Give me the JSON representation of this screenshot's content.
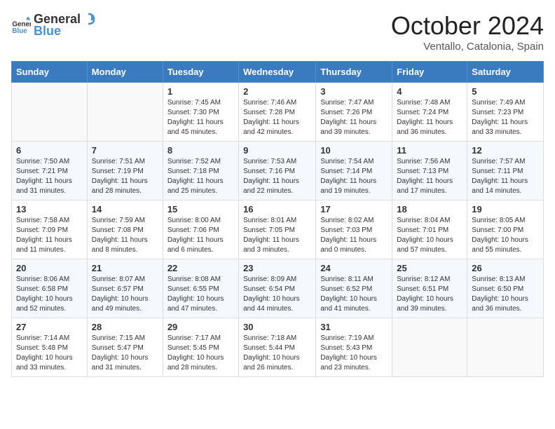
{
  "logo": {
    "general": "General",
    "blue": "Blue"
  },
  "header": {
    "month": "October 2024",
    "location": "Ventallo, Catalonia, Spain"
  },
  "weekdays": [
    "Sunday",
    "Monday",
    "Tuesday",
    "Wednesday",
    "Thursday",
    "Friday",
    "Saturday"
  ],
  "weeks": [
    [
      {
        "day": "",
        "sunrise": "",
        "sunset": "",
        "daylight": ""
      },
      {
        "day": "",
        "sunrise": "",
        "sunset": "",
        "daylight": ""
      },
      {
        "day": "1",
        "sunrise": "Sunrise: 7:45 AM",
        "sunset": "Sunset: 7:30 PM",
        "daylight": "Daylight: 11 hours and 45 minutes."
      },
      {
        "day": "2",
        "sunrise": "Sunrise: 7:46 AM",
        "sunset": "Sunset: 7:28 PM",
        "daylight": "Daylight: 11 hours and 42 minutes."
      },
      {
        "day": "3",
        "sunrise": "Sunrise: 7:47 AM",
        "sunset": "Sunset: 7:26 PM",
        "daylight": "Daylight: 11 hours and 39 minutes."
      },
      {
        "day": "4",
        "sunrise": "Sunrise: 7:48 AM",
        "sunset": "Sunset: 7:24 PM",
        "daylight": "Daylight: 11 hours and 36 minutes."
      },
      {
        "day": "5",
        "sunrise": "Sunrise: 7:49 AM",
        "sunset": "Sunset: 7:23 PM",
        "daylight": "Daylight: 11 hours and 33 minutes."
      }
    ],
    [
      {
        "day": "6",
        "sunrise": "Sunrise: 7:50 AM",
        "sunset": "Sunset: 7:21 PM",
        "daylight": "Daylight: 11 hours and 31 minutes."
      },
      {
        "day": "7",
        "sunrise": "Sunrise: 7:51 AM",
        "sunset": "Sunset: 7:19 PM",
        "daylight": "Daylight: 11 hours and 28 minutes."
      },
      {
        "day": "8",
        "sunrise": "Sunrise: 7:52 AM",
        "sunset": "Sunset: 7:18 PM",
        "daylight": "Daylight: 11 hours and 25 minutes."
      },
      {
        "day": "9",
        "sunrise": "Sunrise: 7:53 AM",
        "sunset": "Sunset: 7:16 PM",
        "daylight": "Daylight: 11 hours and 22 minutes."
      },
      {
        "day": "10",
        "sunrise": "Sunrise: 7:54 AM",
        "sunset": "Sunset: 7:14 PM",
        "daylight": "Daylight: 11 hours and 19 minutes."
      },
      {
        "day": "11",
        "sunrise": "Sunrise: 7:56 AM",
        "sunset": "Sunset: 7:13 PM",
        "daylight": "Daylight: 11 hours and 17 minutes."
      },
      {
        "day": "12",
        "sunrise": "Sunrise: 7:57 AM",
        "sunset": "Sunset: 7:11 PM",
        "daylight": "Daylight: 11 hours and 14 minutes."
      }
    ],
    [
      {
        "day": "13",
        "sunrise": "Sunrise: 7:58 AM",
        "sunset": "Sunset: 7:09 PM",
        "daylight": "Daylight: 11 hours and 11 minutes."
      },
      {
        "day": "14",
        "sunrise": "Sunrise: 7:59 AM",
        "sunset": "Sunset: 7:08 PM",
        "daylight": "Daylight: 11 hours and 8 minutes."
      },
      {
        "day": "15",
        "sunrise": "Sunrise: 8:00 AM",
        "sunset": "Sunset: 7:06 PM",
        "daylight": "Daylight: 11 hours and 6 minutes."
      },
      {
        "day": "16",
        "sunrise": "Sunrise: 8:01 AM",
        "sunset": "Sunset: 7:05 PM",
        "daylight": "Daylight: 11 hours and 3 minutes."
      },
      {
        "day": "17",
        "sunrise": "Sunrise: 8:02 AM",
        "sunset": "Sunset: 7:03 PM",
        "daylight": "Daylight: 11 hours and 0 minutes."
      },
      {
        "day": "18",
        "sunrise": "Sunrise: 8:04 AM",
        "sunset": "Sunset: 7:01 PM",
        "daylight": "Daylight: 10 hours and 57 minutes."
      },
      {
        "day": "19",
        "sunrise": "Sunrise: 8:05 AM",
        "sunset": "Sunset: 7:00 PM",
        "daylight": "Daylight: 10 hours and 55 minutes."
      }
    ],
    [
      {
        "day": "20",
        "sunrise": "Sunrise: 8:06 AM",
        "sunset": "Sunset: 6:58 PM",
        "daylight": "Daylight: 10 hours and 52 minutes."
      },
      {
        "day": "21",
        "sunrise": "Sunrise: 8:07 AM",
        "sunset": "Sunset: 6:57 PM",
        "daylight": "Daylight: 10 hours and 49 minutes."
      },
      {
        "day": "22",
        "sunrise": "Sunrise: 8:08 AM",
        "sunset": "Sunset: 6:55 PM",
        "daylight": "Daylight: 10 hours and 47 minutes."
      },
      {
        "day": "23",
        "sunrise": "Sunrise: 8:09 AM",
        "sunset": "Sunset: 6:54 PM",
        "daylight": "Daylight: 10 hours and 44 minutes."
      },
      {
        "day": "24",
        "sunrise": "Sunrise: 8:11 AM",
        "sunset": "Sunset: 6:52 PM",
        "daylight": "Daylight: 10 hours and 41 minutes."
      },
      {
        "day": "25",
        "sunrise": "Sunrise: 8:12 AM",
        "sunset": "Sunset: 6:51 PM",
        "daylight": "Daylight: 10 hours and 39 minutes."
      },
      {
        "day": "26",
        "sunrise": "Sunrise: 8:13 AM",
        "sunset": "Sunset: 6:50 PM",
        "daylight": "Daylight: 10 hours and 36 minutes."
      }
    ],
    [
      {
        "day": "27",
        "sunrise": "Sunrise: 7:14 AM",
        "sunset": "Sunset: 5:48 PM",
        "daylight": "Daylight: 10 hours and 33 minutes."
      },
      {
        "day": "28",
        "sunrise": "Sunrise: 7:15 AM",
        "sunset": "Sunset: 5:47 PM",
        "daylight": "Daylight: 10 hours and 31 minutes."
      },
      {
        "day": "29",
        "sunrise": "Sunrise: 7:17 AM",
        "sunset": "Sunset: 5:45 PM",
        "daylight": "Daylight: 10 hours and 28 minutes."
      },
      {
        "day": "30",
        "sunrise": "Sunrise: 7:18 AM",
        "sunset": "Sunset: 5:44 PM",
        "daylight": "Daylight: 10 hours and 26 minutes."
      },
      {
        "day": "31",
        "sunrise": "Sunrise: 7:19 AM",
        "sunset": "Sunset: 5:43 PM",
        "daylight": "Daylight: 10 hours and 23 minutes."
      },
      {
        "day": "",
        "sunrise": "",
        "sunset": "",
        "daylight": ""
      },
      {
        "day": "",
        "sunrise": "",
        "sunset": "",
        "daylight": ""
      }
    ]
  ]
}
